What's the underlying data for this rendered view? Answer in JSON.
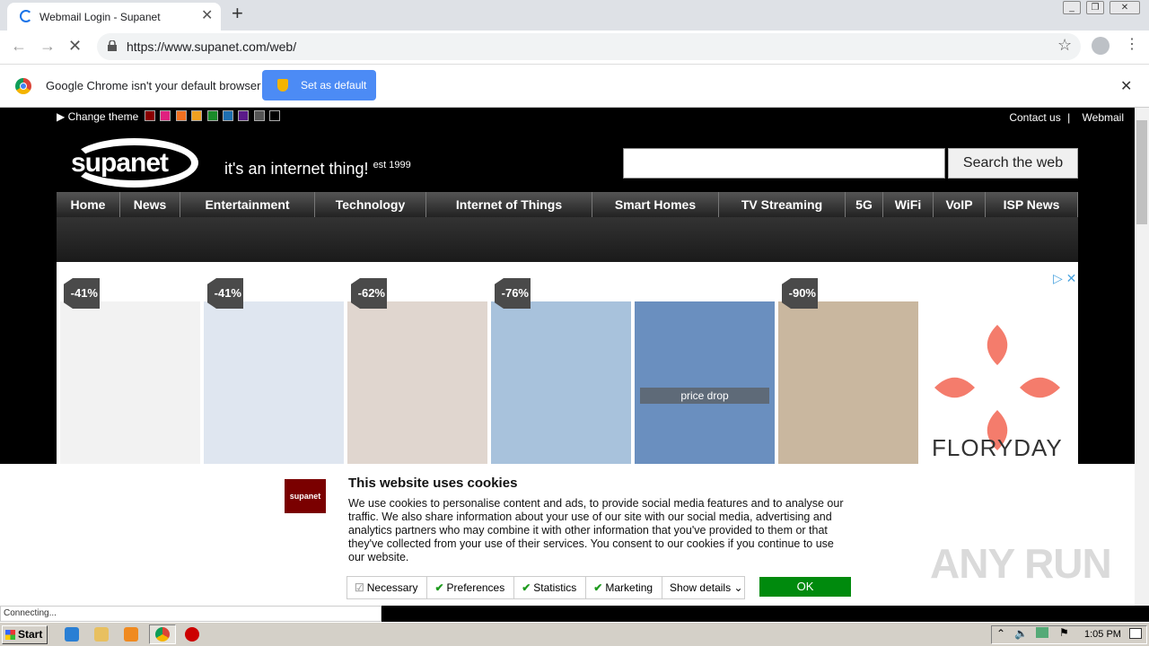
{
  "browser": {
    "tab_title": "Webmail Login - Supanet",
    "url": "https://www.supanet.com/web/",
    "infobar_text": "Google Chrome isn't your default browser",
    "set_default_label": "Set as default",
    "status_text": "Connecting..."
  },
  "site": {
    "change_theme_label": "Change theme",
    "theme_colors": [
      "#8b0000",
      "#e0207f",
      "#f07020",
      "#f0a020",
      "#1a8a2a",
      "#1e6fb0",
      "#5a1a8a",
      "#555555",
      "#000000"
    ],
    "top_links": [
      "Contact us",
      "Webmail"
    ],
    "logo_text": "supanet",
    "tagline": "it's an internet thing!",
    "tagline_est": "est 1999",
    "search_placeholder": "",
    "search_button": "Search the web",
    "nav": [
      "Home",
      "News",
      "Entertainment",
      "Technology",
      "Internet of Things",
      "Smart Homes",
      "TV Streaming",
      "5G",
      "WiFi",
      "VoIP",
      "ISP News"
    ]
  },
  "ad": {
    "items": [
      {
        "discount": "-41%",
        "color": "#f2f2f2"
      },
      {
        "discount": "-41%",
        "color": "#dfe6f0"
      },
      {
        "discount": "-62%",
        "color": "#e0d6cf"
      },
      {
        "discount": "-76%",
        "color": "#a8c2dc"
      },
      {
        "discount": "",
        "color": "#6a8fbf"
      },
      {
        "discount": "-90%",
        "color": "#c9b79f"
      }
    ],
    "price_drop": "price drop",
    "brand": "FLORYDAY"
  },
  "cookie": {
    "logo": "supanet",
    "title": "This website uses cookies",
    "body": "We use cookies to personalise content and ads, to provide social media features and to analyse our traffic. We also share information about your use of our site with our social media, advertising and analytics partners who may combine it with other information that you've provided to them or that they've collected from your use of their services. You consent to our cookies if you continue to use our website.",
    "options": [
      "Necessary",
      "Preferences",
      "Statistics",
      "Marketing"
    ],
    "show_details": "Show details",
    "ok": "OK"
  },
  "watermark": "ANY RUN",
  "taskbar": {
    "start": "Start",
    "clock": "1:05 PM"
  }
}
